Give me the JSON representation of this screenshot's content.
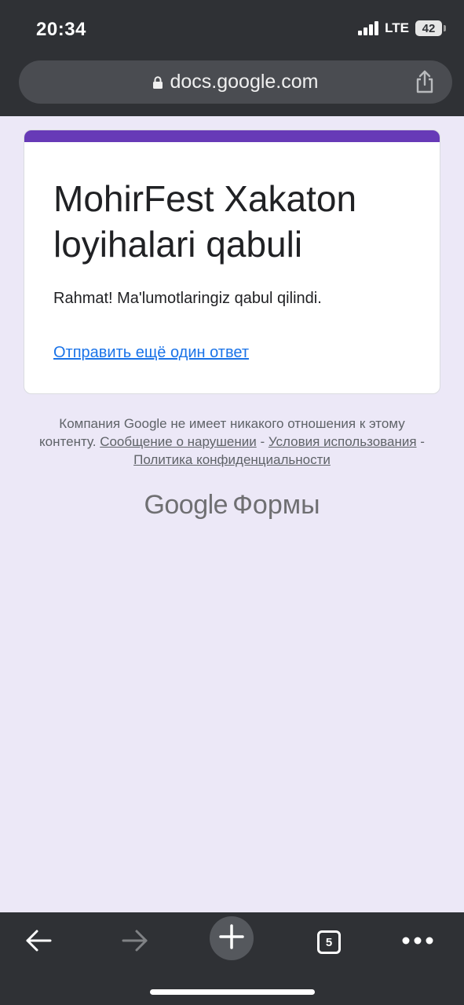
{
  "status_bar": {
    "time": "20:34",
    "network": "LTE",
    "battery": "42"
  },
  "browser": {
    "url": "docs.google.com"
  },
  "form": {
    "title": "MohirFest Xakaton loyihalari qabuli",
    "confirmation": "Rahmat! Ma'lumotlaringiz qabul qilindi.",
    "resubmit_link": "Отправить ещё один ответ",
    "accent_color": "#673ab7"
  },
  "footer": {
    "disclaimer_text": "Компания Google не имеет никакого отношения к этому контенту.",
    "report_link": "Сообщение о нарушении",
    "separator": "-",
    "terms_link": "Условия использования",
    "privacy_link": "Политика конфиденциальности",
    "brand_google": "Google",
    "brand_product": "Формы"
  },
  "toolbar": {
    "tab_count": "5",
    "icons": [
      "back-icon",
      "forward-icon",
      "new-tab-icon",
      "tabs-icon",
      "more-icon"
    ]
  },
  "colors": {
    "page_bg": "#ece8f7",
    "chrome_bg": "#2f3135",
    "link": "#1a73e8"
  }
}
